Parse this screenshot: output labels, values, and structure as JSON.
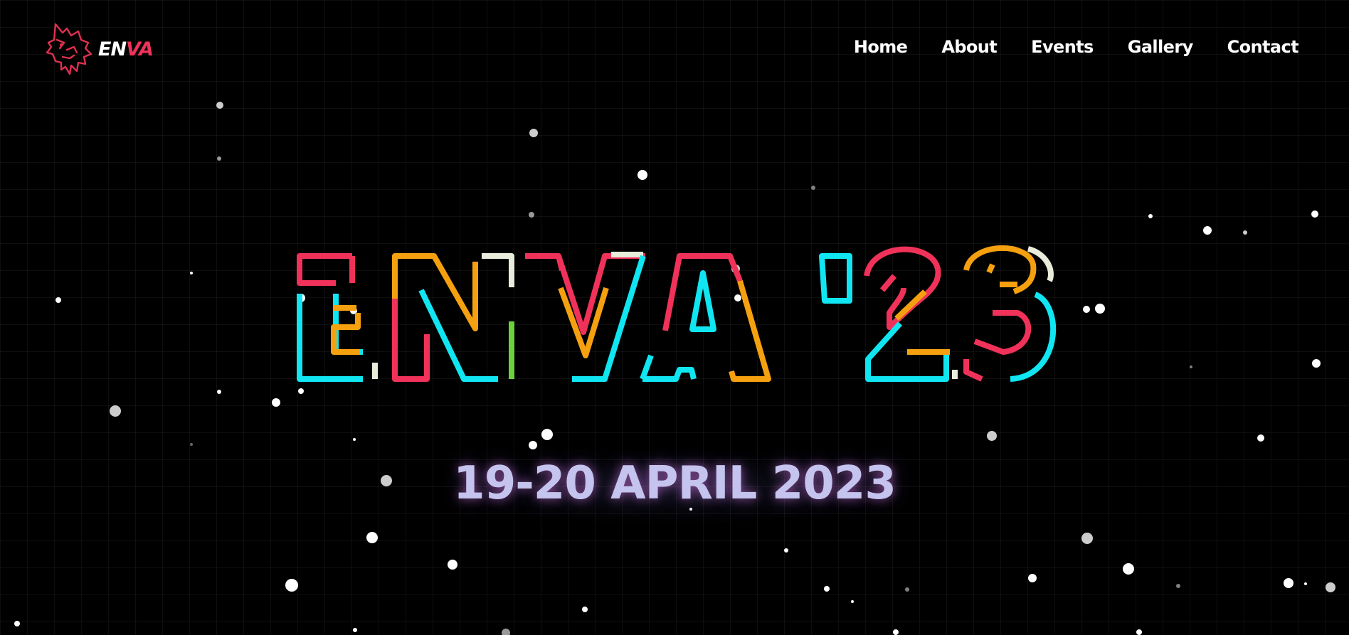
{
  "brand": {
    "logo_word_light": "EN",
    "logo_word_accent": "VA",
    "wolf_icon": "wolf-head-icon"
  },
  "nav": {
    "items": [
      {
        "label": "Home"
      },
      {
        "label": "About"
      },
      {
        "label": "Events"
      },
      {
        "label": "Gallery"
      },
      {
        "label": "Contact"
      }
    ]
  },
  "hero": {
    "title": "ENVA '23",
    "date": "19-20 APRIL 2023"
  },
  "colors": {
    "pink": "#f0325a",
    "cyan": "#10e6f2",
    "orange": "#f5a00f",
    "cream": "#e8ecda",
    "green": "#6cd23c",
    "date_text": "#c4c4ee",
    "background": "#000000"
  }
}
